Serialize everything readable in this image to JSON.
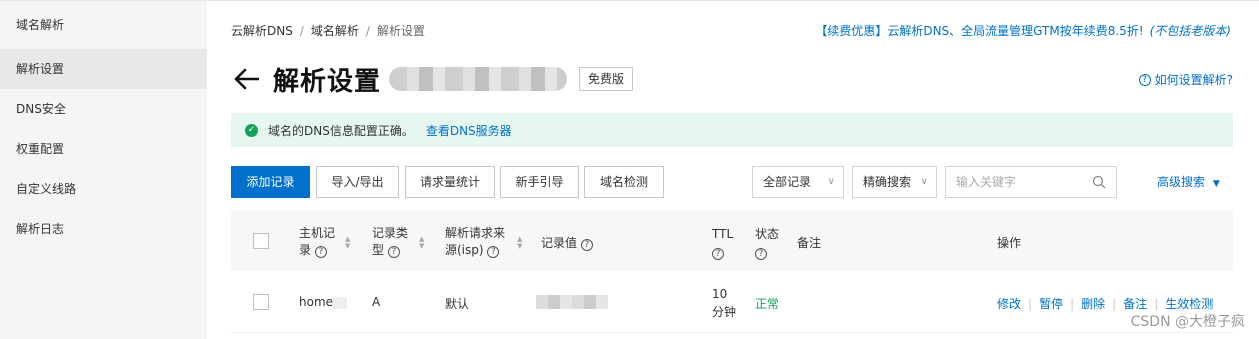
{
  "sidebar": {
    "items": [
      {
        "label": "域名解析"
      },
      {
        "label": "解析设置"
      },
      {
        "label": "DNS安全"
      },
      {
        "label": "权重配置"
      },
      {
        "label": "自定义线路"
      },
      {
        "label": "解析日志"
      }
    ]
  },
  "breadcrumb": [
    "云解析DNS",
    "域名解析",
    "解析设置"
  ],
  "promo": {
    "text": "【续费优惠】云解析DNS、全局流量管理GTM按年续费8.5折!",
    "note": "(不包括老版本)"
  },
  "title": {
    "text": "解析设置",
    "badge": "免费版"
  },
  "help_link": "如何设置解析?",
  "alert": {
    "text": "域名的DNS信息配置正确。",
    "link": "查看DNS服务器"
  },
  "toolbar": {
    "add": "添加记录",
    "import": "导入/导出",
    "stats": "请求量统计",
    "guide": "新手引导",
    "check": "域名检测",
    "filter_all": "全部记录",
    "precise": "精确搜索",
    "search_placeholder": "输入关键字",
    "advanced": "高级搜索"
  },
  "table": {
    "headers": {
      "host_1": "主机记",
      "host_2": "录",
      "type_1": "记录类",
      "type_2": "型",
      "source_1": "解析请求来",
      "source_2": "源(isp)",
      "value": "记录值",
      "ttl": "TTL",
      "status": "状态",
      "remark": "备注",
      "ops": "操作"
    },
    "rows": [
      {
        "host": "home",
        "type": "A",
        "source": "默认",
        "ttl_1": "10",
        "ttl_2": "分钟",
        "status": "正常",
        "ops": [
          "修改",
          "暂停",
          "删除",
          "备注",
          "生效检测"
        ]
      }
    ]
  },
  "watermark": "CSDN @大橙子疯",
  "colors": {
    "accent": "#0070cc",
    "success": "#14a05b",
    "alert_bg": "#e6f7ef"
  }
}
